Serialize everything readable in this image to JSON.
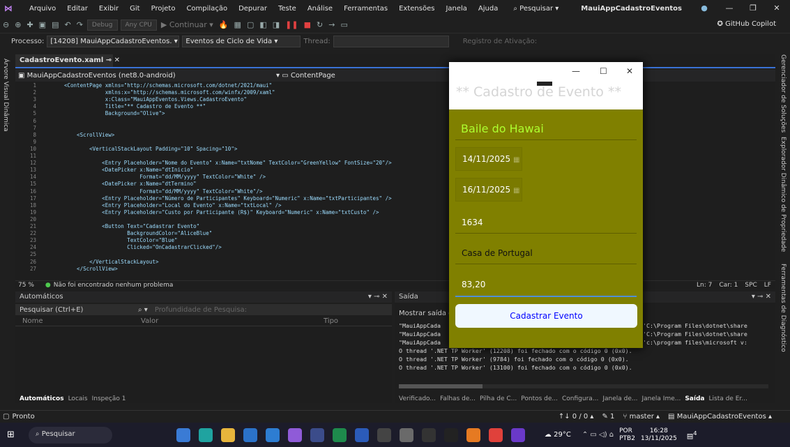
{
  "menubar": {
    "items": [
      "Arquivo",
      "Editar",
      "Exibir",
      "Git",
      "Projeto",
      "Compilação",
      "Depurar",
      "Teste",
      "Análise",
      "Ferramentas",
      "Extensões",
      "Janela",
      "Ajuda"
    ],
    "search_label": "Pesquisar",
    "solution_name": "MauiAppCadastroEventos"
  },
  "toolbar": {
    "config": "Debug",
    "platform": "Any CPU",
    "continue": "Continuar",
    "copilot": "GitHub Copilot"
  },
  "procbar": {
    "process_label": "Processo:",
    "process_value": "[14208] MauiAppCadastroEventos.",
    "lifecycle": "Eventos de Ciclo de Vida",
    "thread_label": "Thread:",
    "stack": "Registro de Ativação:"
  },
  "leftrail": {
    "label": "Árvore Visual Dinâmica"
  },
  "rightrail": {
    "labels": [
      "Gerenciador de Soluções",
      "Explorador Dinâmico de Propriedade",
      "Ferramentas de Diagnóstico"
    ]
  },
  "editor": {
    "tab": "CadastroEvento.xaml",
    "context_left": "MauiAppCadastroEventos (net8.0-android)",
    "context_right": "ContentPage",
    "zoom": "75 %",
    "problems": "Não foi encontrado nenhum problema",
    "ln": "Ln: 7",
    "car": "Car: 1",
    "spc": "SPC",
    "lf": "LF",
    "lines": [
      {
        "n": "1",
        "t": "<ContentPage xmlns=\"http://schemas.microsoft.com/dotnet/2021/maui\""
      },
      {
        "n": "2",
        "t": "             xmlns:x=\"http://schemas.microsoft.com/winfx/2009/xaml\""
      },
      {
        "n": "3",
        "t": "             x:Class=\"MauiAppEventos.Views.CadastroEvento\""
      },
      {
        "n": "4",
        "t": "             Title=\"** Cadastro de Evento **\""
      },
      {
        "n": "5",
        "t": "             Background=\"Olive\">"
      },
      {
        "n": "6",
        "t": ""
      },
      {
        "n": "7",
        "t": ""
      },
      {
        "n": "8",
        "t": "    <ScrollView>"
      },
      {
        "n": "9",
        "t": ""
      },
      {
        "n": "10",
        "t": "        <VerticalStackLayout Padding=\"10\" Spacing=\"10\">"
      },
      {
        "n": "11",
        "t": ""
      },
      {
        "n": "12",
        "t": "            <Entry Placeholder=\"Nome do Evento\" x:Name=\"txtNome\" TextColor=\"GreenYellow\" FontSize=\"20\"/>"
      },
      {
        "n": "13",
        "t": "            <DatePicker x:Name=\"dtInicio\""
      },
      {
        "n": "14",
        "t": "                        Format=\"dd/MM/yyyy\" TextColor=\"White\" />"
      },
      {
        "n": "15",
        "t": "            <DatePicker x:Name=\"dtTermino\""
      },
      {
        "n": "16",
        "t": "                        Format=\"dd/MM/yyyy\" TextColor=\"White\"/>"
      },
      {
        "n": "17",
        "t": "            <Entry Placeholder=\"Número de Participantes\" Keyboard=\"Numeric\" x:Name=\"txtParticipantes\" />"
      },
      {
        "n": "18",
        "t": "            <Entry Placeholder=\"Local do Evento\" x:Name=\"txtLocal\" />"
      },
      {
        "n": "19",
        "t": "            <Entry Placeholder=\"Custo por Participante (R$)\" Keyboard=\"Numeric\" x:Name=\"txtCusto\" />"
      },
      {
        "n": "20",
        "t": ""
      },
      {
        "n": "21",
        "t": "            <Button Text=\"Cadastrar Evento\""
      },
      {
        "n": "22",
        "t": "                    BackgroundColor=\"AliceBlue\""
      },
      {
        "n": "23",
        "t": "                    TextColor=\"Blue\""
      },
      {
        "n": "24",
        "t": "                    Clicked=\"OnCadastrarClicked\"/>"
      },
      {
        "n": "25",
        "t": ""
      },
      {
        "n": "26",
        "t": "        </VerticalStackLayout>"
      },
      {
        "n": "27",
        "t": "    </ScrollView>"
      }
    ]
  },
  "autos": {
    "title": "Automáticos",
    "search_placeholder": "Pesquisar (Ctrl+E)",
    "depth": "Profundidade de Pesquisa:",
    "columns": [
      "Nome",
      "Valor",
      "Tipo"
    ],
    "tabs": [
      "Automáticos",
      "Locais",
      "Inspeção 1"
    ]
  },
  "output": {
    "title": "Saída",
    "show_from": "Mostrar saída de",
    "lines": [
      "\"MauiAppCada",
      "\"MauiAppCada",
      "\"MauiAppCada",
      "O thread '.NET TP Worker' (12208) foi fechado com o código 0 (0x0).",
      "O thread '.NET TP Worker' (9784) foi fechado com o código 0 (0x0).",
      "O thread '.NET TP Worker' (13100) foi fechado com o código 0 (0x0)."
    ],
    "right_fragments": [
      "'C:\\Program Files\\dotnet\\share",
      "'C:\\Program Files\\dotnet\\share",
      "'c:\\program files\\microsoft v:"
    ],
    "tabs": [
      "Verificado...",
      "Falhas de...",
      "Pilha de C...",
      "Pontos de...",
      "Configura...",
      "Janela de...",
      "Janela Ime...",
      "Saída",
      "Lista de Er..."
    ]
  },
  "statusbar": {
    "left": "Pronto",
    "git": "↑↓ 0 / 0 ▴",
    "pencil": "1",
    "branch": "master ▴",
    "project": "MauiAppCadastroEventos ▴"
  },
  "taskbar": {
    "search": "Pesquisar",
    "weather": "29°C",
    "lang1": "POR",
    "lang2": "PTB2",
    "time": "16:28",
    "date": "13/11/2025",
    "notif": "4"
  },
  "app": {
    "title": "** Cadastro de Evento **",
    "name": "Baile do Hawai",
    "date_start": "14/11/2025",
    "date_end": "16/11/2025",
    "participants": "1634",
    "location": "Casa de Portugal",
    "cost": "83,20",
    "button": "Cadastrar Evento",
    "bg": "#808000",
    "accent": "#adff2f"
  }
}
